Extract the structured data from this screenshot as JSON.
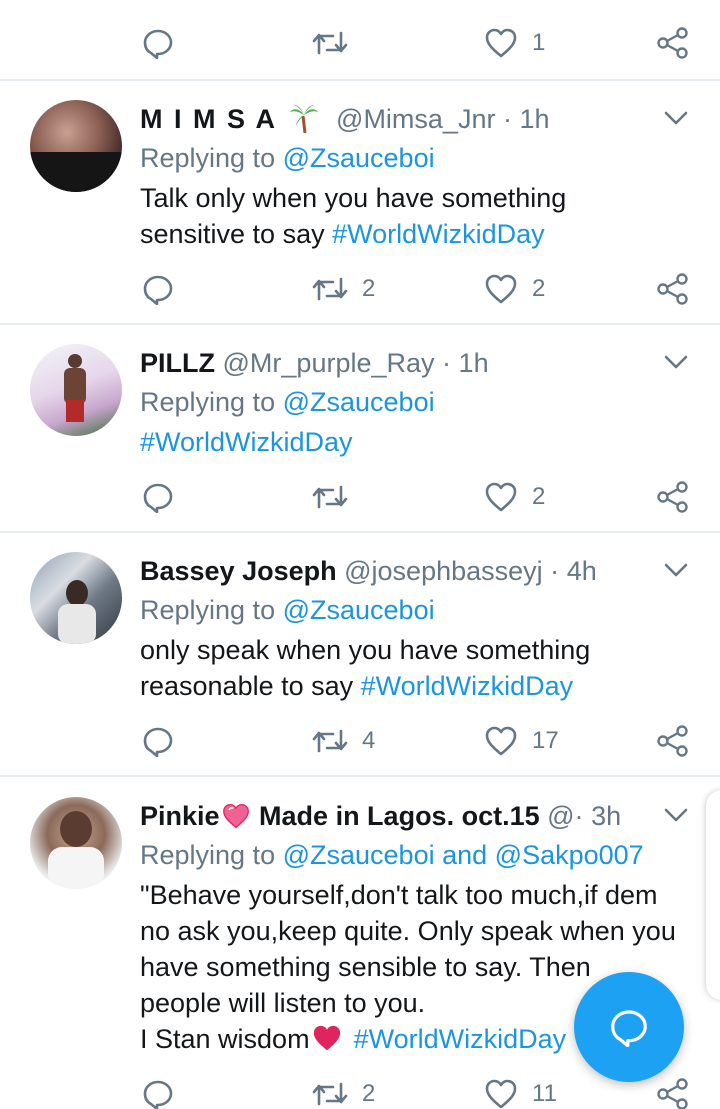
{
  "colors": {
    "accent": "#1b95e0",
    "secondary_text": "#657786",
    "fab": "#1da1f2",
    "heart_red": "#e0245e"
  },
  "top_actions": {
    "retweet_count": "",
    "like_count": "1"
  },
  "tweets": [
    {
      "name": "M I M S A",
      "name_emoji": "palm-tree",
      "handle": "@Mimsa_Jnr",
      "dot": "·",
      "time": "1h",
      "replying_prefix": "Replying to",
      "replying_to": "@Zsauceboi",
      "body_lines": [
        "Talk only when you have something",
        "sensitive to say "
      ],
      "hashtag": "#WorldWizkidDay",
      "reply_count": "",
      "retweet_count": "2",
      "like_count": "2"
    },
    {
      "name": "PILLZ",
      "handle": "@Mr_purple_Ray",
      "dot": "·",
      "time": "1h",
      "replying_prefix": "Replying to",
      "replying_to": "@Zsauceboi",
      "body_lines": [],
      "hashtag": "#WorldWizkidDay",
      "retweet_count": "",
      "like_count": "2"
    },
    {
      "name": "Bassey Joseph",
      "handle": "@josephbasseyj",
      "dot": "·",
      "time": "4h",
      "replying_prefix": "Replying to",
      "replying_to": "@Zsauceboi",
      "body_lines": [
        "only speak when you have something",
        "reasonable to say "
      ],
      "hashtag": "#WorldWizkidDay",
      "retweet_count": "4",
      "like_count": "17"
    },
    {
      "name": "Pinkie",
      "name_suffix": " Made in Lagos. oct.15",
      "handle": "@",
      "dot": "·",
      "time": "3h",
      "replying_prefix": "Replying to",
      "replying_to": "@Zsauceboi",
      "replying_and": " and ",
      "replying_to_2": "@Sakpo007",
      "body_lines": [
        "\"Behave yourself,don't talk too much,if dem",
        "no ask you,keep quite. Only speak when you",
        "have something sensible to say. Then",
        "people will listen to you.",
        "I Stan wisdom"
      ],
      "hashtag": "#WorldWizkidDay",
      "retweet_count": "2",
      "like_count": "11"
    }
  ]
}
